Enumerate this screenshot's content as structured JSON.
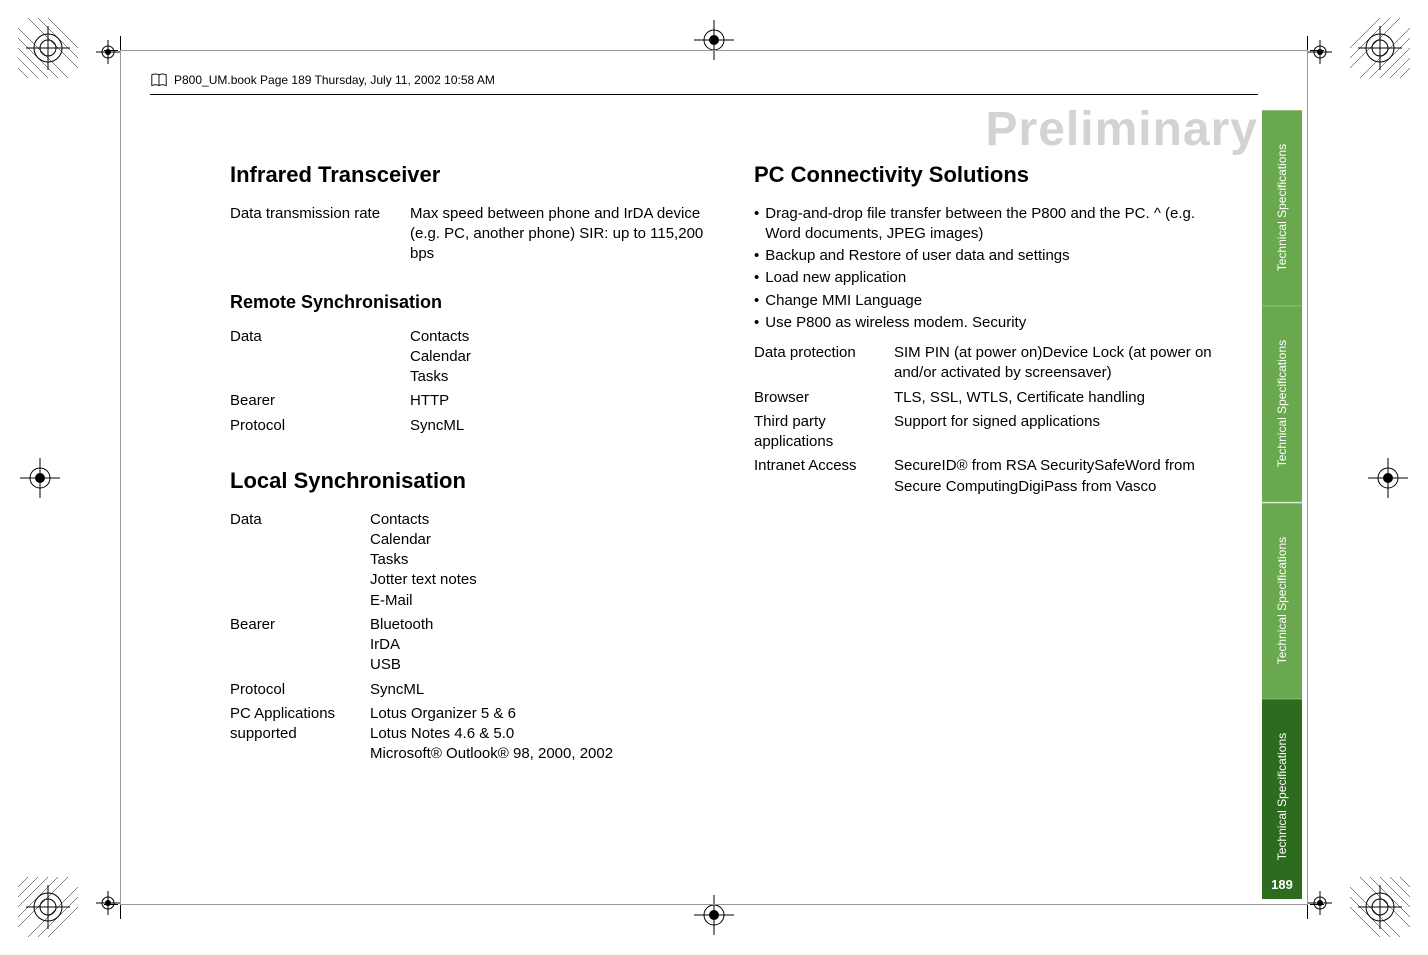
{
  "running_header": "P800_UM.book  Page 189  Thursday, July 11, 2002  10:58 AM",
  "watermark": "Preliminary",
  "left": {
    "section1": {
      "title": "Infrared Transceiver",
      "rows": [
        {
          "k": "Data transmission rate",
          "v": "Max speed between phone and IrDA device (e.g. PC, another phone) SIR: up to 115,200 bps"
        }
      ]
    },
    "section2": {
      "title": "Remote Synchronisation",
      "rows": [
        {
          "k": "Data",
          "v": "Contacts\nCalendar\nTasks"
        },
        {
          "k": "Bearer",
          "v": "HTTP"
        },
        {
          "k": "Protocol",
          "v": "SyncML"
        }
      ]
    },
    "section3": {
      "title": "Local Synchronisation",
      "rows": [
        {
          "k": "Data",
          "v": "Contacts\nCalendar\nTasks\nJotter text notes\nE-Mail"
        },
        {
          "k": "Bearer",
          "v": "Bluetooth\nIrDA\nUSB"
        },
        {
          "k": "Protocol",
          "v": "SyncML"
        },
        {
          "k": "PC Applications supported",
          "v": "Lotus Organizer 5 & 6\nLotus Notes 4.6 & 5.0\nMicrosoft® Outlook® 98, 2000, 2002"
        }
      ]
    }
  },
  "right": {
    "title": "PC Connectivity Solutions",
    "bullets": [
      "Drag-and-drop file transfer between the P800 and the PC. ^ (e.g. Word documents, JPEG images)",
      "Backup and Restore of user data and settings",
      "Load new application",
      "Change MMI Language",
      "Use P800 as wireless modem. Security"
    ],
    "rows": [
      {
        "k": "Data protection",
        "v": "SIM PIN (at power on)Device Lock (at power on and/or activated by screensaver)"
      },
      {
        "k": "Browser",
        "v": "TLS, SSL, WTLS, Certificate handling"
      },
      {
        "k": "Third party applications",
        "v": "Support for signed applications"
      },
      {
        "k": "Intranet Access",
        "v": "SecureID® from RSA SecuritySafeWord from Secure ComputingDigiPass from Vasco"
      }
    ]
  },
  "tabs": [
    "Technical Specifications",
    "Technical Specifications",
    "Technical Specifications",
    "Technical Specifications"
  ],
  "page_number": "189"
}
